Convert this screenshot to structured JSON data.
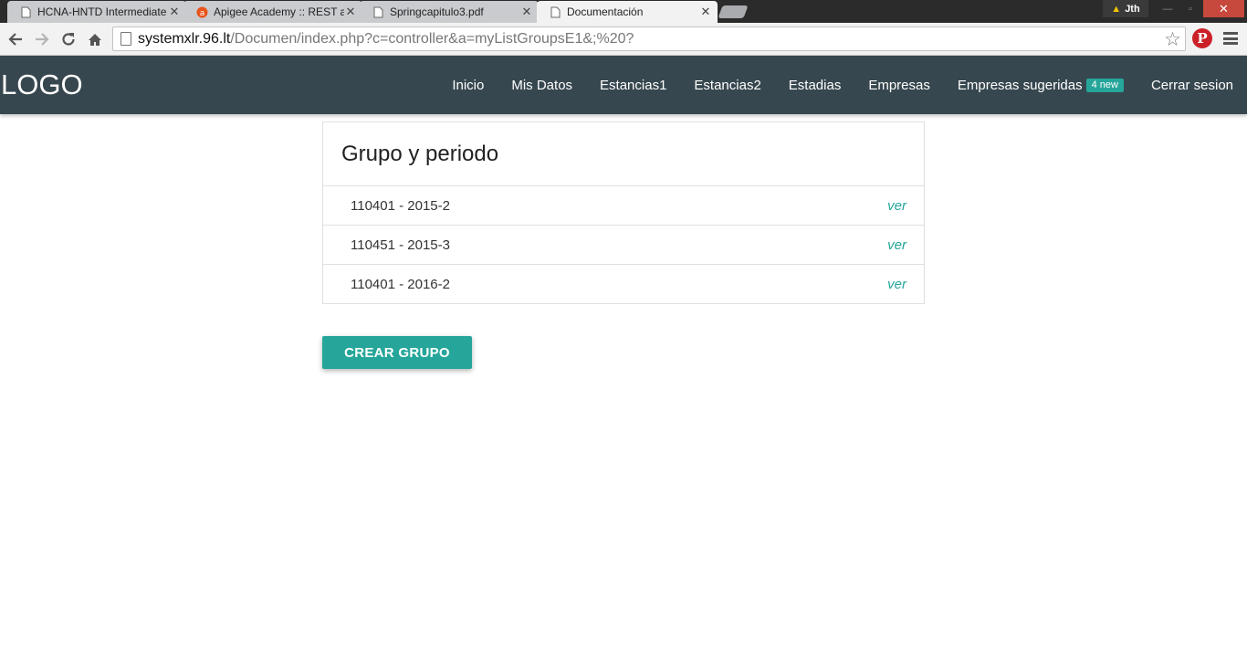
{
  "browser": {
    "tabs": [
      {
        "title": "HCNA-HNTD Intermediate",
        "icon": "page-icon"
      },
      {
        "title": "Apigee Academy :: REST ar",
        "icon": "apigee-icon"
      },
      {
        "title": "Springcapitulo3.pdf",
        "icon": "page-icon"
      },
      {
        "title": "Documentación",
        "icon": "page-icon"
      }
    ],
    "tab_close": "✕",
    "profile_name": "Jth",
    "window_close": "✕",
    "url_host": "systemxlr.96.lt",
    "url_path": "/Documen/index.php?c=controller&a=myListGroupsE1&;%20?",
    "colors": {
      "tabstrip": "#2b2b2b",
      "toolbar": "#f2f2f2",
      "pinterest": "#cb2027"
    }
  },
  "navbar": {
    "logo": "LOGO",
    "links": [
      {
        "label": "Inicio"
      },
      {
        "label": "Mis Datos"
      },
      {
        "label": "Estancias1"
      },
      {
        "label": "Estancias2"
      },
      {
        "label": "Estadias"
      },
      {
        "label": "Empresas"
      },
      {
        "label": "Empresas sugeridas",
        "badge": "4 new"
      },
      {
        "label": "Cerrar sesion"
      }
    ],
    "color": "#37474f"
  },
  "groups": {
    "header": "Grupo y periodo",
    "items": [
      {
        "label": "110401 - 2015-2",
        "action": "ver"
      },
      {
        "label": "110451 - 2015-3",
        "action": "ver"
      },
      {
        "label": "110401 - 2016-2",
        "action": "ver"
      }
    ],
    "create_button": "CREAR GRUPO",
    "accent": "#26a69a"
  }
}
